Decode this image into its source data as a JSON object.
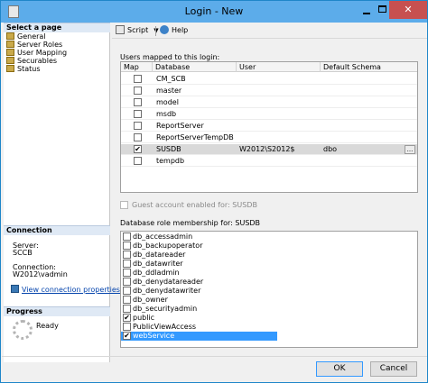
{
  "window": {
    "title": "Login - New"
  },
  "left_panel": {
    "select_page_header": "Select a page",
    "pages": [
      "General",
      "Server Roles",
      "User Mapping",
      "Securables",
      "Status"
    ],
    "connection_header": "Connection",
    "server_label": "Server:",
    "server_value": "SCCB",
    "connection_label": "Connection:",
    "connection_value": "W2012\\vadmin",
    "view_connection_link": "View connection properties",
    "progress_header": "Progress",
    "progress_status": "Ready"
  },
  "toolbar": {
    "script_label": "Script",
    "help_label": "Help"
  },
  "user_mapping": {
    "label": "Users mapped to this login:",
    "columns": [
      "Map",
      "Database",
      "User",
      "Default Schema"
    ],
    "rows": [
      {
        "map": false,
        "database": "CM_SCB",
        "user": "",
        "schema": ""
      },
      {
        "map": false,
        "database": "master",
        "user": "",
        "schema": ""
      },
      {
        "map": false,
        "database": "model",
        "user": "",
        "schema": ""
      },
      {
        "map": false,
        "database": "msdb",
        "user": "",
        "schema": ""
      },
      {
        "map": false,
        "database": "ReportServer",
        "user": "",
        "schema": ""
      },
      {
        "map": false,
        "database": "ReportServerTempDB",
        "user": "",
        "schema": ""
      },
      {
        "map": true,
        "database": "SUSDB",
        "user": "W2012\\S2012$",
        "schema": "dbo",
        "selected": true
      },
      {
        "map": false,
        "database": "tempdb",
        "user": "",
        "schema": ""
      }
    ],
    "ellipsis": "..."
  },
  "guest_account": {
    "label": "Guest account enabled for: SUSDB",
    "checked": false,
    "enabled": false
  },
  "role_membership": {
    "label": "Database role membership for: SUSDB",
    "roles": [
      {
        "name": "db_accessadmin",
        "checked": false
      },
      {
        "name": "db_backupoperator",
        "checked": false
      },
      {
        "name": "db_datareader",
        "checked": false
      },
      {
        "name": "db_datawriter",
        "checked": false
      },
      {
        "name": "db_ddladmin",
        "checked": false
      },
      {
        "name": "db_denydatareader",
        "checked": false
      },
      {
        "name": "db_denydatawriter",
        "checked": false
      },
      {
        "name": "db_owner",
        "checked": false
      },
      {
        "name": "db_securityadmin",
        "checked": false
      },
      {
        "name": "public",
        "checked": true
      },
      {
        "name": "PublicViewAccess",
        "checked": false
      },
      {
        "name": "webService",
        "checked": true,
        "selected": true
      }
    ]
  },
  "buttons": {
    "ok": "OK",
    "cancel": "Cancel"
  },
  "colors": {
    "titlebar": "#5cacea",
    "close": "#c75050",
    "selection": "#3399ff",
    "link": "#0645ad"
  }
}
